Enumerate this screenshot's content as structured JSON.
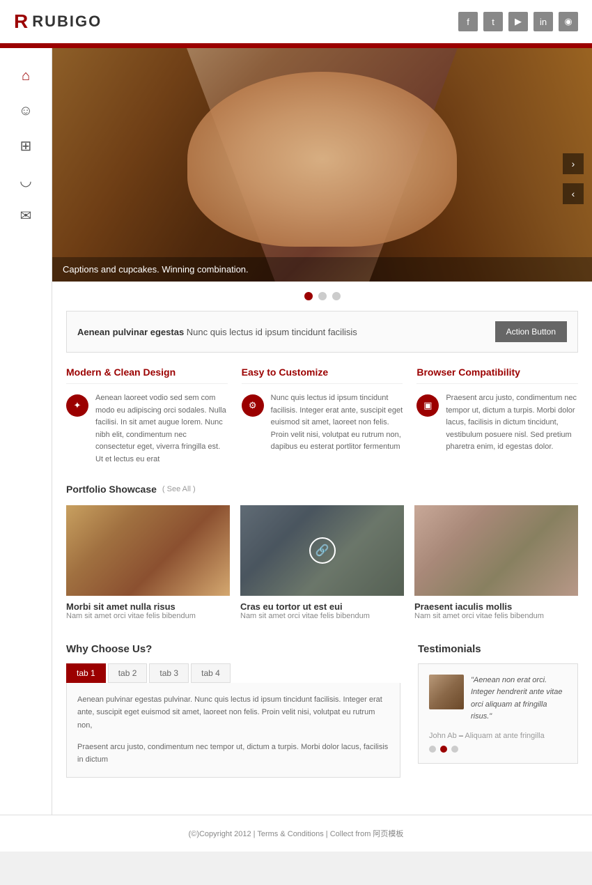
{
  "header": {
    "logo_icon": "R",
    "logo_text": "RUBIGO",
    "social": [
      {
        "name": "facebook",
        "icon": "f"
      },
      {
        "name": "twitter",
        "icon": "t"
      },
      {
        "name": "youtube",
        "icon": "▶"
      },
      {
        "name": "linkedin",
        "icon": "in"
      },
      {
        "name": "rss",
        "icon": "◉"
      }
    ]
  },
  "hero": {
    "caption": "Captions and cupcakes. Winning combination.",
    "next_label": "›",
    "prev_label": "‹",
    "dots": [
      {
        "active": true
      },
      {
        "active": false
      },
      {
        "active": false
      }
    ]
  },
  "action_bar": {
    "text_bold": "Aenean pulvinar egestas",
    "text_normal": "Nunc quis lectus id ipsum tincidunt facilisis",
    "button_label": "Action Button"
  },
  "features": [
    {
      "title": "Modern & Clean Design",
      "icon": "✦",
      "text": "Aenean laoreet vodio sed sem com modo eu adipiscing orci sodales. Nulla facilisi. In sit amet augue lorem. Nunc nibh elit, condimentum nec consectetur eget, viverra fringilla est. Ut et lectus eu erat"
    },
    {
      "title": "Easy to Customize",
      "icon": "⚙",
      "text": "Nunc quis lectus id ipsum tincidunt facilisis. Integer erat ante, suscipit eget euismod sit amet, laoreet non felis. Proin velit nisi, volutpat eu rutrum non, dapibus eu esterat portlitor fermentum"
    },
    {
      "title": "Browser Compatibility",
      "icon": "▣",
      "text": "Praesent arcu justo, condimentum nec tempor ut, dictum a turpis. Morbi dolor lacus, facilisis in dictum tincidunt, vestibulum posuere nisl. Sed pretium pharetra enim, id egestas dolor."
    }
  ],
  "portfolio": {
    "title": "Portfolio Showcase",
    "see_all": "( See All )",
    "items": [
      {
        "name": "Morbi sit amet nulla risus",
        "desc": "Nam sit amet orci vitae felis bibendum"
      },
      {
        "name": "Cras eu tortor ut est eui",
        "desc": "Nam sit amet orci vitae felis bibendum"
      },
      {
        "name": "Praesent iaculis mollis",
        "desc": "Nam sit amet orci vitae felis bibendum"
      }
    ]
  },
  "why_choose": {
    "title": "Why Choose Us?",
    "tabs": [
      "tab 1",
      "tab 2",
      "tab 3",
      "tab 4"
    ],
    "text_1": "Aenean pulvinar egestas pulvinar. Nunc quis lectus id ipsum tincidunt facilisis. Integer erat ante, suscipit eget euismod sit amet, laoreet non felis. Proin velit nisi, volutpat eu rutrum non,",
    "text_2": "Praesent arcu justo, condimentum nec tempor ut, dictum a turpis. Morbi dolor lacus, facilisis in dictum"
  },
  "testimonials": {
    "title": "Testimonials",
    "quote": "\"Aenean non erat orci. Integer hendrerit ante vitae orci aliquam at fringilla risus.\"",
    "author_name": "John Ab",
    "author_sub": "Aliquam at ante fringilla",
    "dots": [
      {
        "active": false
      },
      {
        "active": true
      },
      {
        "active": false
      }
    ]
  },
  "footer": {
    "text": "(©)Copyright 2012 | Terms & Conditions | Collect from 阿页模板"
  },
  "nav_icons": [
    {
      "name": "home-icon",
      "symbol": "⌂"
    },
    {
      "name": "user-icon",
      "symbol": "👤"
    },
    {
      "name": "grid-icon",
      "symbol": "⊞"
    },
    {
      "name": "chat-icon",
      "symbol": "💬"
    },
    {
      "name": "mail-icon",
      "symbol": "✉"
    }
  ]
}
